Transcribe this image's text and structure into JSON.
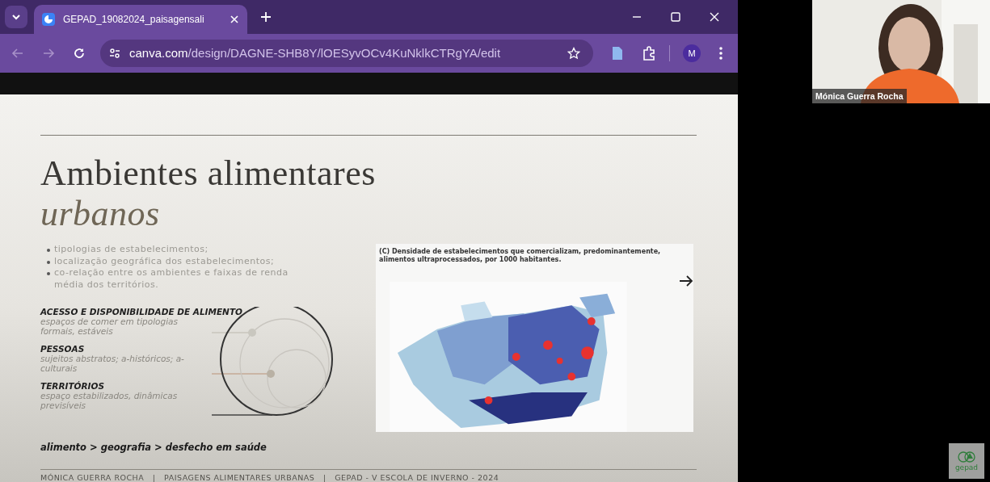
{
  "browser": {
    "tabs": [
      {
        "title": "GEPAD_19082024_paisagensali",
        "selected": true
      }
    ],
    "url_host": "canva.com",
    "url_path": "/design/DAGNE-SHB8Y/lOESyvOCv4KuNklkCTRgYA/edit",
    "profile_initial": "M"
  },
  "slide": {
    "title": "Ambientes alimentares",
    "title_emphasis": "urbanos",
    "bullets": [
      "tipologias de estabelecimentos;",
      "localização geográfica dos estabelecimentos;",
      "co-relação entre os ambientes e faixas de renda média dos territórios."
    ],
    "concepts": [
      {
        "heading": "ACESSO E DISPONIBILIDADE DE ALIMENTO",
        "description": "espaços de comer em tipologias formais, estáveis"
      },
      {
        "heading": "PESSOAS",
        "description": "sujeitos abstratos; a-históricos; a-culturais"
      },
      {
        "heading": "TERRITÓRIOS",
        "description": "espaço estabilizados, dinâmicas previsíveis"
      }
    ],
    "summary": "alimento > geografia > desfecho em saúde",
    "figure": {
      "caption": "(C) Densidade de estabelecimentos que comercializam, predominantemente, alimentos ultraprocessados,  por 1000 habitantes.",
      "kind": "picture"
    },
    "footer": "MÓNICA GUERRA ROCHA   |   PAISAGENS ALIMENTARES URBANAS   |   GEPAD - V ESCOLA DE INVERNO - 2024"
  },
  "video": {
    "participant": "Mónica Guerra Rocha"
  },
  "logo": {
    "text": "gepad"
  }
}
